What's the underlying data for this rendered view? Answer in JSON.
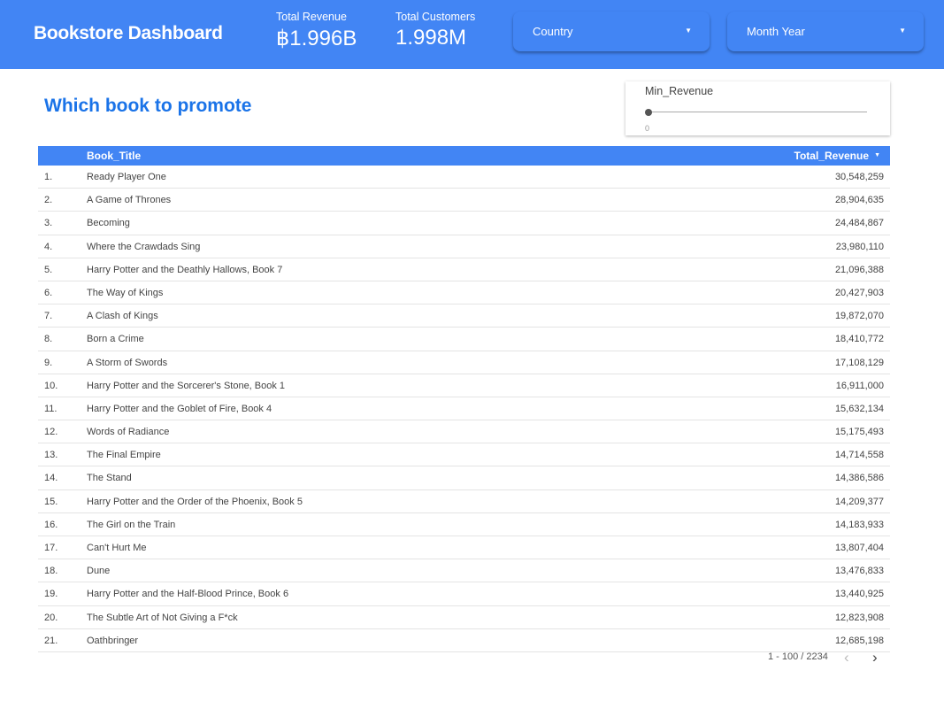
{
  "header": {
    "title": "Bookstore Dashboard",
    "kpis": [
      {
        "label": "Total Revenue",
        "value": "฿1.996B"
      },
      {
        "label": "Total Customers",
        "value": "1.998M"
      }
    ],
    "filters": [
      {
        "label": "Country"
      },
      {
        "label": "Month Year"
      }
    ]
  },
  "section_title": "Which book to promote",
  "slider": {
    "label": "Min_Revenue",
    "value": "0",
    "fraction": 0
  },
  "table": {
    "columns": [
      "Book_Title",
      "Total_Revenue"
    ],
    "sort": "descending",
    "rows": [
      [
        "1.",
        "Ready Player One",
        "30,548,259"
      ],
      [
        "2.",
        "A Game of Thrones",
        "28,904,635"
      ],
      [
        "3.",
        "Becoming",
        "24,484,867"
      ],
      [
        "4.",
        "Where the Crawdads Sing",
        "23,980,110"
      ],
      [
        "5.",
        "Harry Potter and the Deathly Hallows, Book 7",
        "21,096,388"
      ],
      [
        "6.",
        "The Way of Kings",
        "20,427,903"
      ],
      [
        "7.",
        "A Clash of Kings",
        "19,872,070"
      ],
      [
        "8.",
        "Born a Crime",
        "18,410,772"
      ],
      [
        "9.",
        "A Storm of Swords",
        "17,108,129"
      ],
      [
        "10.",
        "Harry Potter and the Sorcerer's Stone, Book 1",
        "16,911,000"
      ],
      [
        "11.",
        "Harry Potter and the Goblet of Fire, Book 4",
        "15,632,134"
      ],
      [
        "12.",
        "Words of Radiance",
        "15,175,493"
      ],
      [
        "13.",
        "The Final Empire",
        "14,714,558"
      ],
      [
        "14.",
        "The Stand",
        "14,386,586"
      ],
      [
        "15.",
        "Harry Potter and the Order of the Phoenix, Book 5",
        "14,209,377"
      ],
      [
        "16.",
        "The Girl on the Train",
        "14,183,933"
      ],
      [
        "17.",
        "Can't Hurt Me",
        "13,807,404"
      ],
      [
        "18.",
        "Dune",
        "13,476,833"
      ],
      [
        "19.",
        "Harry Potter and the Half-Blood Prince, Book 6",
        "13,440,925"
      ],
      [
        "20.",
        "The Subtle Art of Not Giving a F*ck",
        "12,823,908"
      ],
      [
        "21.",
        "Oathbringer",
        "12,685,198"
      ]
    ],
    "pagination": "1 - 100 / 2234"
  },
  "colors": {
    "primary": "#4285f4",
    "title": "#1a73e8"
  }
}
